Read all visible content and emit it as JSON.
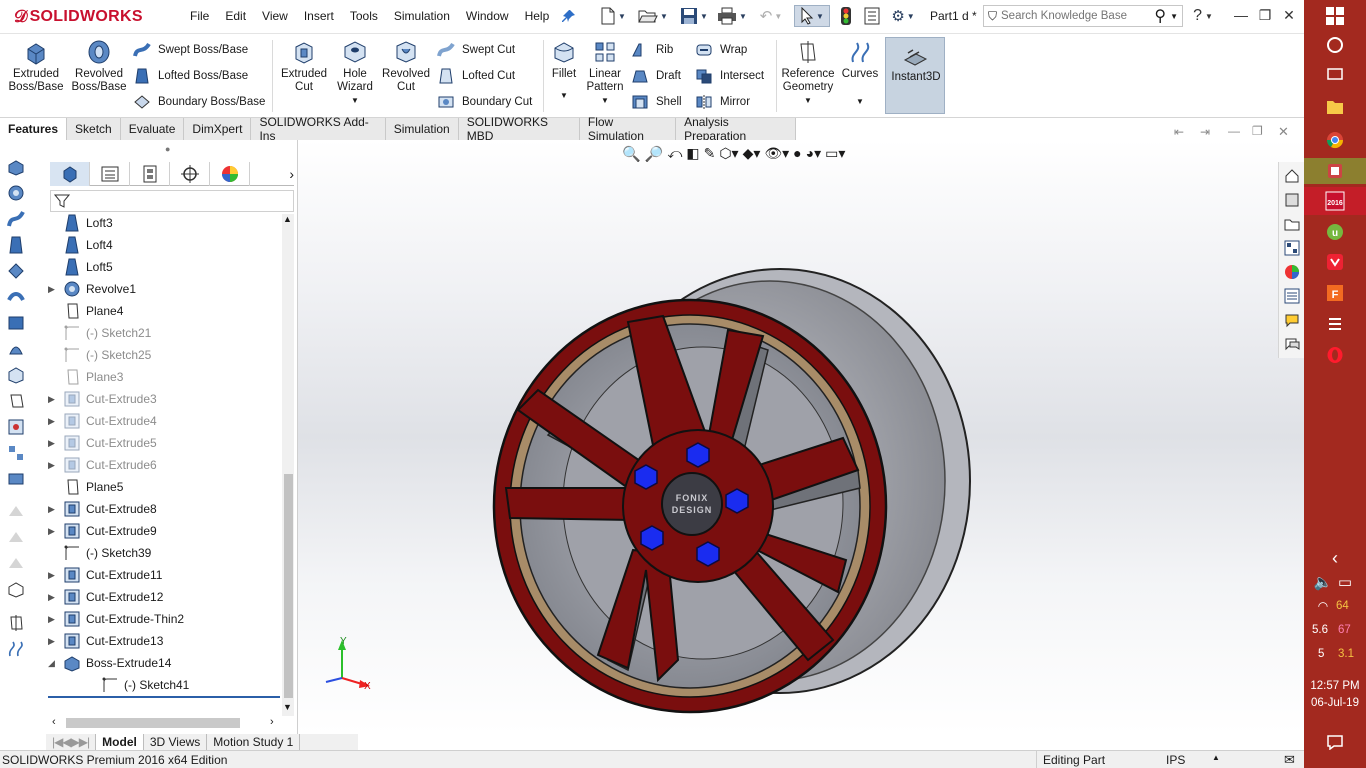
{
  "app": {
    "brand": "SOLIDWORKS",
    "doc_title": "Part1 d *",
    "menu": [
      "File",
      "Edit",
      "View",
      "Insert",
      "Tools",
      "Simulation",
      "Window",
      "Help"
    ],
    "search_placeholder": "Search Knowledge Base",
    "help_label": "?"
  },
  "ribbon": {
    "extruded_boss": "Extruded Boss/Base",
    "revolved_boss": "Revolved Boss/Base",
    "swept_boss": "Swept Boss/Base",
    "lofted_boss": "Lofted Boss/Base",
    "boundary_boss": "Boundary Boss/Base",
    "extruded_cut": "Extruded Cut",
    "hole_wizard": "Hole Wizard",
    "revolved_cut": "Revolved Cut",
    "swept_cut": "Swept Cut",
    "lofted_cut": "Lofted Cut",
    "boundary_cut": "Boundary Cut",
    "fillet": "Fillet",
    "linear_pattern": "Linear Pattern",
    "rib": "Rib",
    "draft": "Draft",
    "shell": "Shell",
    "wrap": "Wrap",
    "intersect": "Intersect",
    "mirror": "Mirror",
    "reference_geometry": "Reference Geometry",
    "curves": "Curves",
    "instant3d": "Instant3D"
  },
  "command_tabs": [
    "Features",
    "Sketch",
    "Evaluate",
    "DimXpert",
    "SOLIDWORKS Add-Ins",
    "Simulation",
    "SOLIDWORKS MBD",
    "Flow Simulation",
    "Analysis Preparation"
  ],
  "tree": [
    {
      "label": "Loft3",
      "icon": "loft-icon",
      "expandable": false,
      "suppressed": false
    },
    {
      "label": "Loft4",
      "icon": "loft-icon",
      "expandable": false,
      "suppressed": false
    },
    {
      "label": "Loft5",
      "icon": "loft-icon",
      "expandable": false,
      "suppressed": false
    },
    {
      "label": "Revolve1",
      "icon": "revolve-icon",
      "expandable": true,
      "suppressed": false
    },
    {
      "label": "Plane4",
      "icon": "plane-icon",
      "expandable": false,
      "suppressed": false
    },
    {
      "label": "(-) Sketch21",
      "icon": "sketch-icon",
      "expandable": false,
      "suppressed": true
    },
    {
      "label": "(-) Sketch25",
      "icon": "sketch-icon",
      "expandable": false,
      "suppressed": true
    },
    {
      "label": "Plane3",
      "icon": "plane-icon",
      "expandable": false,
      "suppressed": true
    },
    {
      "label": "Cut-Extrude3",
      "icon": "cut-extrude-icon",
      "expandable": true,
      "suppressed": true
    },
    {
      "label": "Cut-Extrude4",
      "icon": "cut-extrude-icon",
      "expandable": true,
      "suppressed": true
    },
    {
      "label": "Cut-Extrude5",
      "icon": "cut-extrude-icon",
      "expandable": true,
      "suppressed": true
    },
    {
      "label": "Cut-Extrude6",
      "icon": "cut-extrude-icon",
      "expandable": true,
      "suppressed": true
    },
    {
      "label": "Plane5",
      "icon": "plane-icon",
      "expandable": false,
      "suppressed": false
    },
    {
      "label": "Cut-Extrude8",
      "icon": "cut-extrude-icon",
      "expandable": true,
      "suppressed": false
    },
    {
      "label": "Cut-Extrude9",
      "icon": "cut-extrude-icon",
      "expandable": true,
      "suppressed": false
    },
    {
      "label": "(-) Sketch39",
      "icon": "sketch-icon",
      "expandable": false,
      "suppressed": false
    },
    {
      "label": "Cut-Extrude11",
      "icon": "cut-extrude-icon",
      "expandable": true,
      "suppressed": false
    },
    {
      "label": "Cut-Extrude12",
      "icon": "cut-extrude-icon",
      "expandable": true,
      "suppressed": false
    },
    {
      "label": "Cut-Extrude-Thin2",
      "icon": "cut-extrude-icon",
      "expandable": true,
      "suppressed": false
    },
    {
      "label": "Cut-Extrude13",
      "icon": "cut-extrude-icon",
      "expandable": true,
      "suppressed": false
    },
    {
      "label": "Boss-Extrude14",
      "icon": "boss-extrude-icon",
      "expandable": true,
      "expanded": true,
      "suppressed": false
    },
    {
      "label": "(-) Sketch41",
      "icon": "sketch-icon",
      "expandable": false,
      "suppressed": false,
      "child": true
    }
  ],
  "bottom_tabs": [
    "Model",
    "3D Views",
    "Motion Study 1"
  ],
  "status": {
    "edition": "SOLIDWORKS Premium 2016 x64 Edition",
    "mode": "Editing Part",
    "units": "IPS"
  },
  "viewport": {
    "center_cap_text_1": "FONIX",
    "center_cap_text_2": "DESIGN",
    "axis_x": "X",
    "axis_y": "Y"
  },
  "colors": {
    "rim_face": "#7a0e0e",
    "bolt": "#1a2cf0",
    "barrel": "#8e8e94",
    "taskbar": "#a3291f"
  },
  "taskbar": {
    "time": "12:57 PM",
    "date": "06-Jul-19",
    "tray_1": "64",
    "tray_2": "5.6",
    "tray_3": "67",
    "tray_4": "5",
    "tray_5": "3.1"
  }
}
